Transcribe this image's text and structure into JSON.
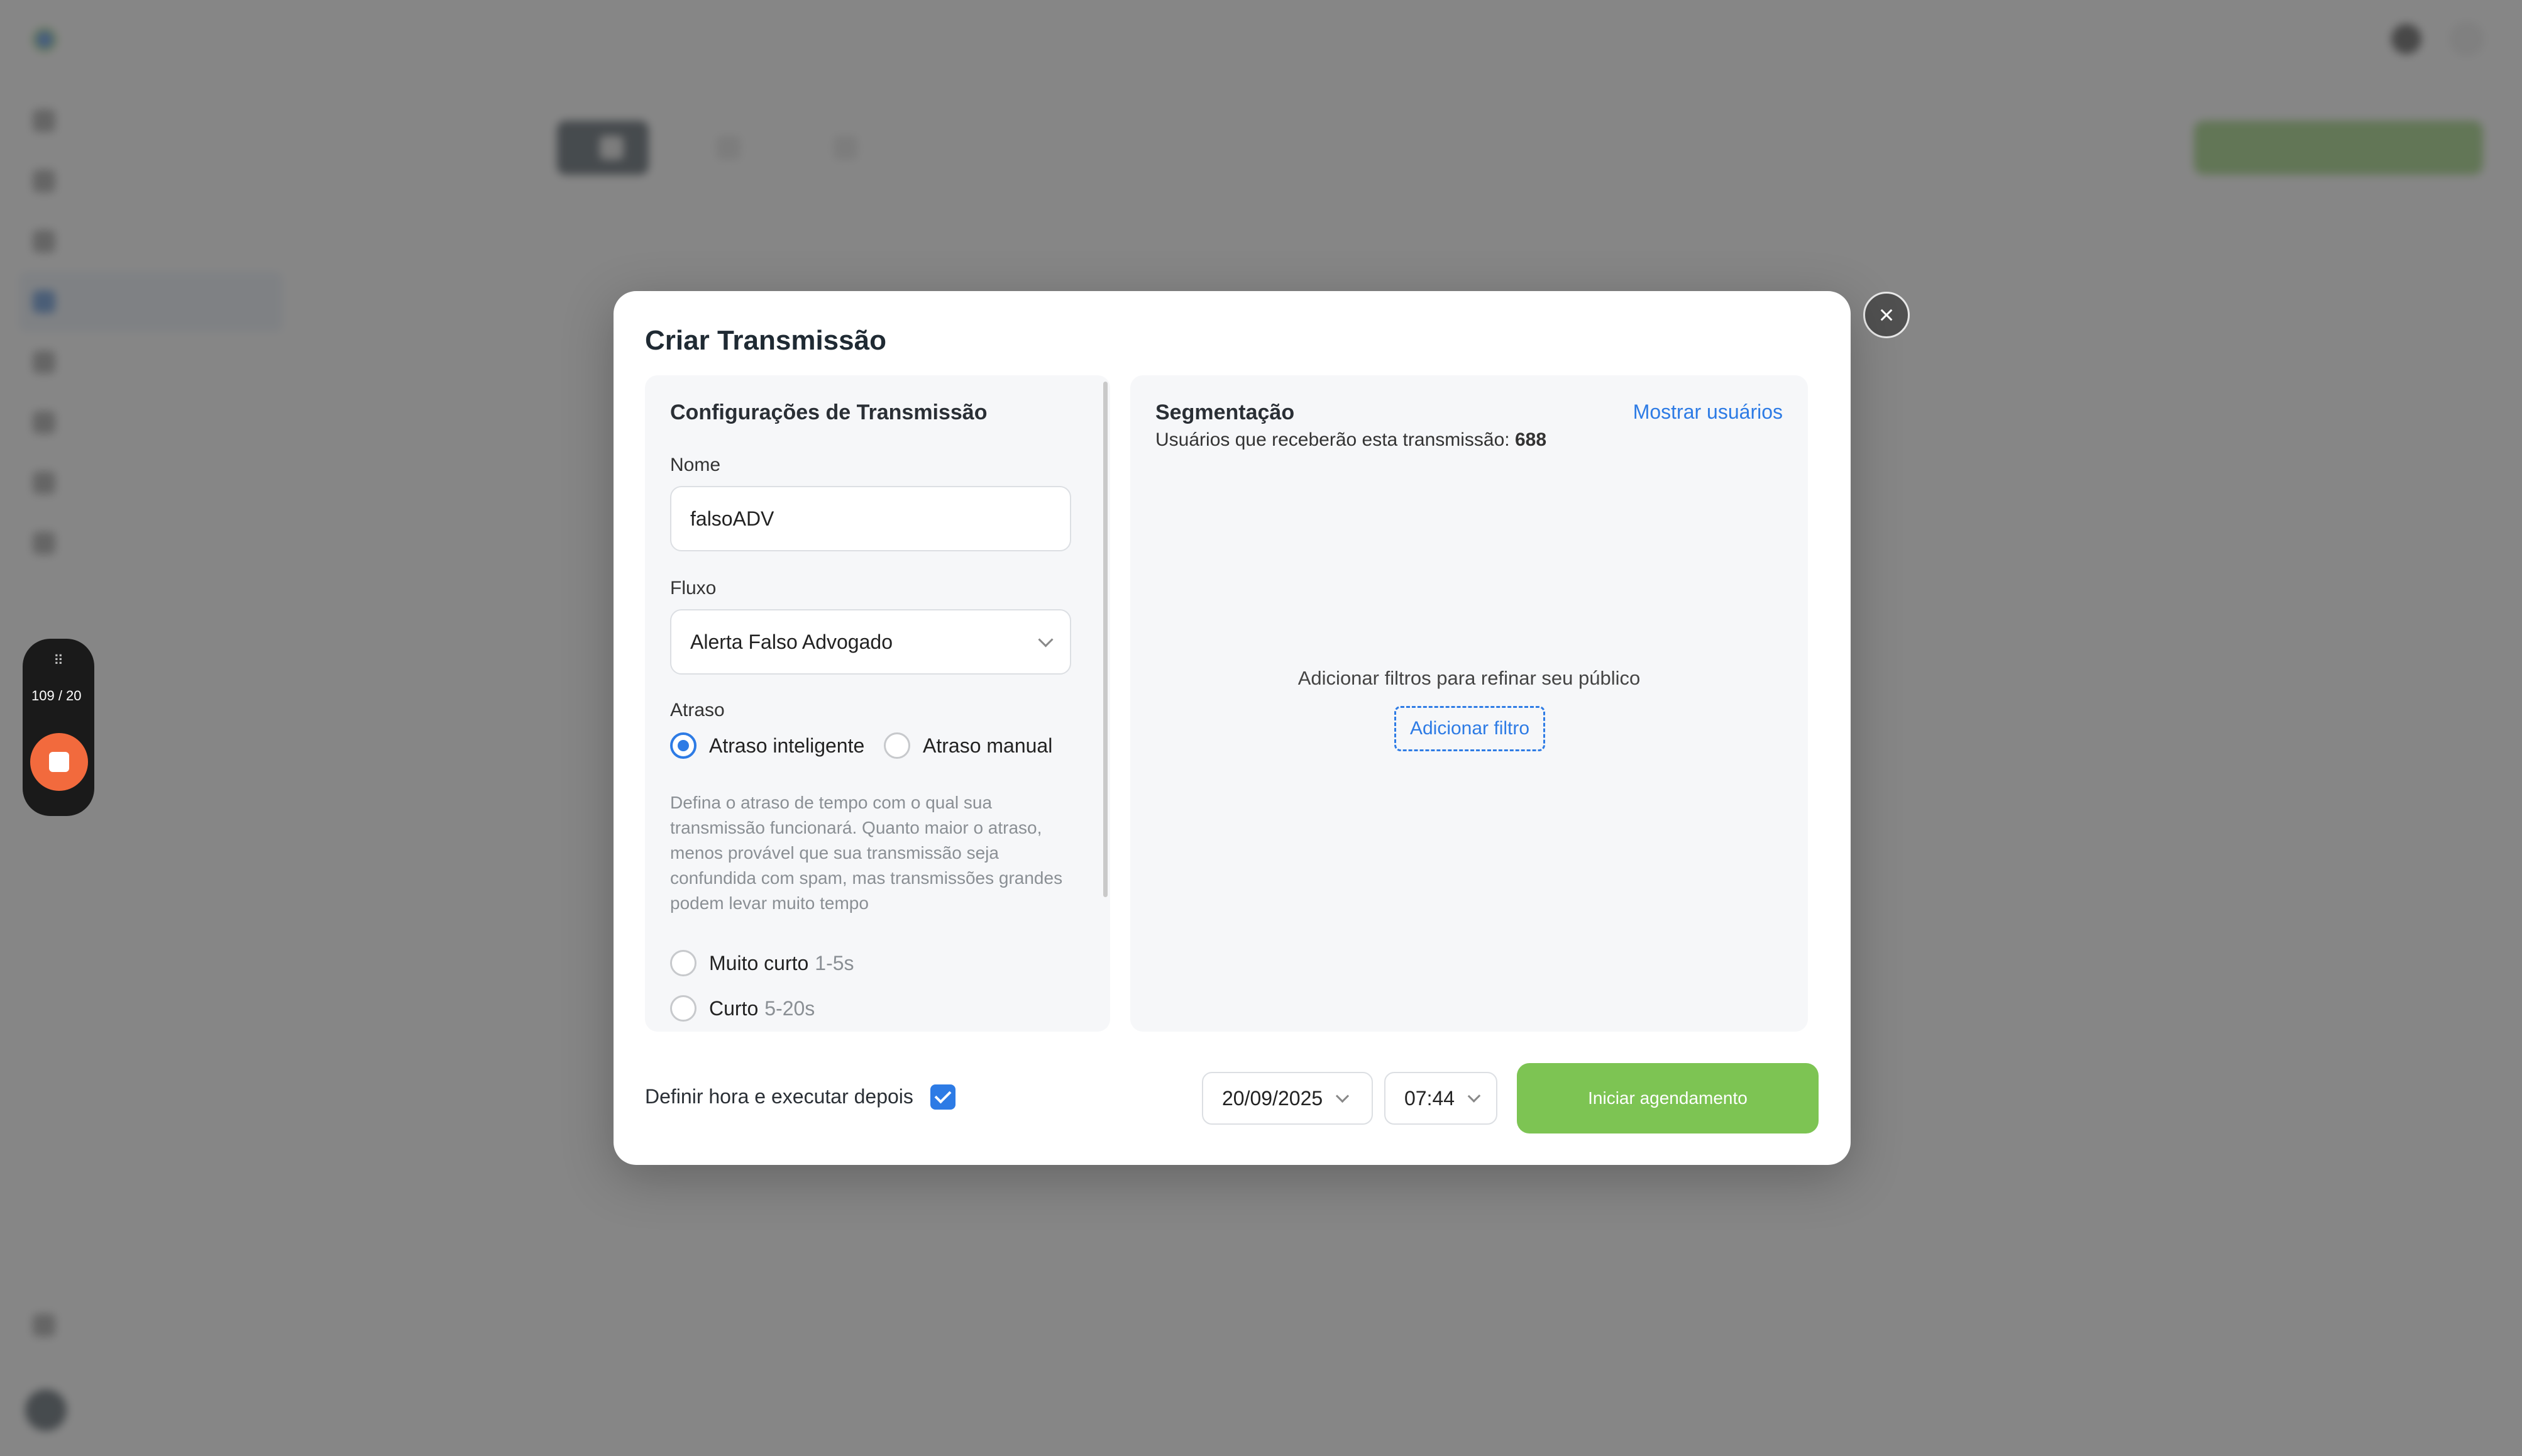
{
  "background": {
    "app_name": "",
    "user_initials": "",
    "sidebar_items": [
      "",
      "",
      "",
      "",
      "",
      "",
      "",
      ""
    ],
    "sidebar_bottom_item": "",
    "profile_name": "",
    "profile_email": "",
    "page_title": "",
    "tabs": [
      {
        "label": "",
        "count": ""
      },
      {
        "label": "",
        "count": ""
      },
      {
        "label": "",
        "count": ""
      }
    ],
    "new_button_label": ""
  },
  "recorder": {
    "counter": "109 / 20"
  },
  "modal": {
    "title": "Criar Transmissão",
    "settings": {
      "heading": "Configurações de Transmissão",
      "name_label": "Nome",
      "name_value": "falsoADV",
      "flow_label": "Fluxo",
      "flow_value": "Alerta Falso Advogado",
      "delay_label": "Atraso",
      "delay_options": [
        {
          "label": "Atraso inteligente",
          "selected": true
        },
        {
          "label": "Atraso manual",
          "selected": false
        }
      ],
      "delay_help": "Defina o atraso de tempo com o qual sua transmissão funcionará. Quanto maior o atraso, menos provável que sua transmissão seja confundida com spam, mas transmissões grandes podem levar muito tempo",
      "speed_options": [
        {
          "label": "Muito curto",
          "range": "1-5s",
          "selected": false
        },
        {
          "label": "Curto",
          "range": "5-20s",
          "selected": false
        }
      ]
    },
    "segmentation": {
      "heading": "Segmentação",
      "show_users_link": "Mostrar usuários",
      "recipients_text": "Usuários que receberão esta transmissão:",
      "recipients_count": "688",
      "empty_message": "Adicionar filtros para refinar seu público",
      "add_filter_label": "Adicionar filtro"
    },
    "footer": {
      "schedule_label": "Definir hora e executar depois",
      "schedule_checked": true,
      "date_value": "20/09/2025",
      "time_value": "07:44",
      "start_button": "Iniciar agendamento"
    }
  },
  "colors": {
    "accent_blue": "#2d7be5",
    "accent_green": "#7dc453",
    "overlay": "#585858"
  }
}
